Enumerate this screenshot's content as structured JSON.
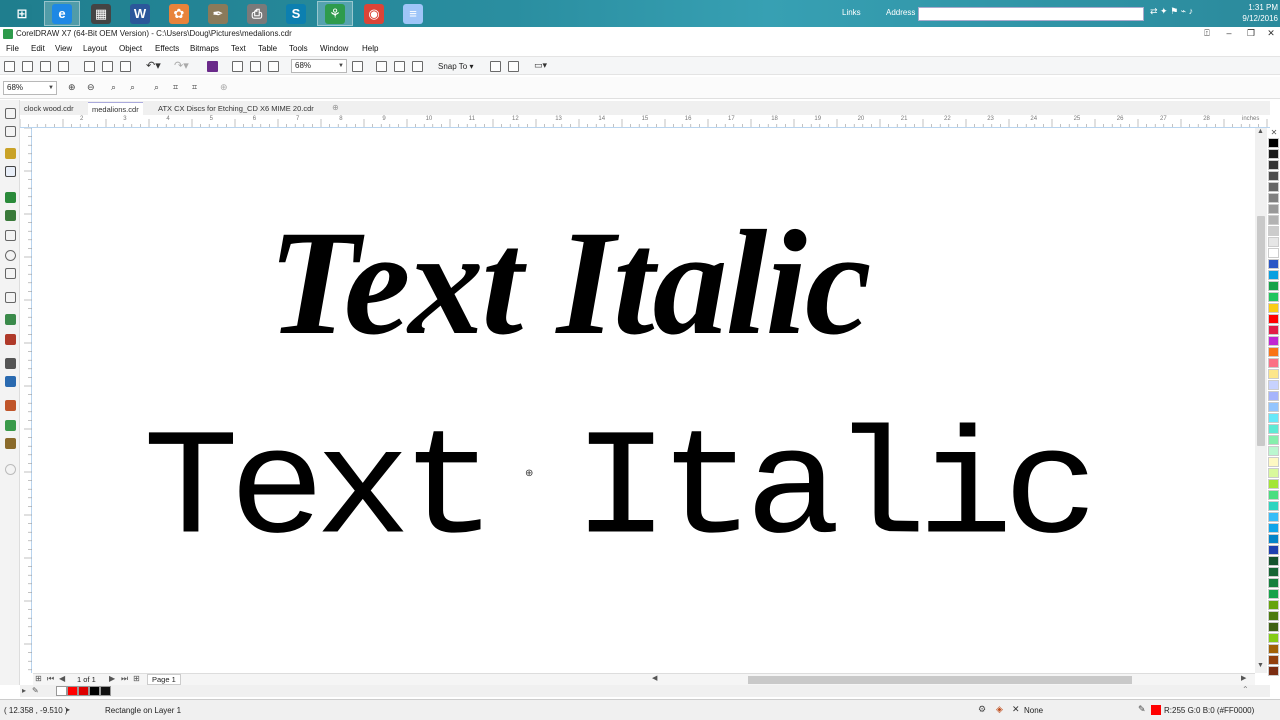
{
  "taskbar": {
    "apps": [
      {
        "name": "windows-start-icon",
        "glyph": "⊞",
        "color": "#1f7e8e"
      },
      {
        "name": "internet-explorer-icon",
        "glyph": "e",
        "color": "#1e88e5"
      },
      {
        "name": "film-app-icon",
        "glyph": "▦",
        "color": "#444444"
      },
      {
        "name": "word-icon",
        "glyph": "W",
        "color": "#2b579a"
      },
      {
        "name": "paint-app-icon",
        "glyph": "✿",
        "color": "#e8833a"
      },
      {
        "name": "pen-app-icon",
        "glyph": "✒",
        "color": "#8a7a5a"
      },
      {
        "name": "printer-app-icon",
        "glyph": "⎙",
        "color": "#7a7a7a"
      },
      {
        "name": "s-app-icon",
        "glyph": "S",
        "color": "#0c7fb0"
      },
      {
        "name": "coreldraw-icon",
        "glyph": "⚘",
        "color": "#2e9b4c"
      },
      {
        "name": "chrome-icon",
        "glyph": "◉",
        "color": "#db4437"
      },
      {
        "name": "notepad-icon",
        "glyph": "≡",
        "color": "#9fc5f8"
      }
    ],
    "links_label": "Links",
    "address_label": "Address",
    "clock_time": "1:31 PM",
    "clock_date": "9/12/2016"
  },
  "window": {
    "title": "CorelDRAW X7 (64-Bit OEM Version) - C:\\Users\\Doug\\Pictures\\medalions.cdr"
  },
  "menu": {
    "items": [
      "File",
      "Edit",
      "View",
      "Layout",
      "Object",
      "Effects",
      "Bitmaps",
      "Text",
      "Table",
      "Tools",
      "Window",
      "Help"
    ]
  },
  "toolbar": {
    "zoom_value": "68%",
    "snap_label": "Snap To"
  },
  "property_bar": {
    "zoom_value": "68%"
  },
  "doc_tabs": [
    "clock wood.cdr",
    "medalions.cdr",
    "ATX CX Discs for Etching_CD X6 MIME 20.cdr"
  ],
  "ruler": {
    "labels": [
      "2",
      "3",
      "4",
      "5",
      "6",
      "7",
      "8",
      "9",
      "10",
      "11",
      "12",
      "13",
      "14",
      "15",
      "16",
      "17",
      "18",
      "19",
      "20",
      "21",
      "22",
      "23",
      "24",
      "25",
      "26",
      "27",
      "28"
    ],
    "units": "inches"
  },
  "canvas": {
    "line1": "Text Italic",
    "line2": "Text Italic"
  },
  "page_nav": {
    "page_count": "1 of 1",
    "page_tab": "Page 1"
  },
  "status": {
    "coordinates": "( 12.358 , -9.510 )",
    "object_info": "Rectangle on Layer 1",
    "fill_label": "None",
    "color_info": "R:255 G:0 B:0 (#FF0000)"
  },
  "palette_colors": [
    "#000000",
    "#1a1a1a",
    "#333333",
    "#4d4d4d",
    "#666666",
    "#808080",
    "#999999",
    "#b3b3b3",
    "#cccccc",
    "#e6e6e6",
    "#ffffff",
    "#2a56c6",
    "#0aa0e0",
    "#16a34a",
    "#22c55e",
    "#facc15",
    "#ff0000",
    "#e11d48",
    "#c026d3",
    "#f97316",
    "#fb7185",
    "#fde68a",
    "#c7d2fe",
    "#a5b4fc",
    "#93c5fd",
    "#67e8f9",
    "#5eead4",
    "#86efac",
    "#bbf7d0",
    "#fef9c3",
    "#d9f99d",
    "#a3e635",
    "#4ade80",
    "#2dd4bf",
    "#38bdf8",
    "#0ea5e9",
    "#0284c7",
    "#1e40af",
    "#14532d",
    "#166534",
    "#15803d",
    "#16a34a",
    "#65a30d",
    "#4d7c0f",
    "#3f6212",
    "#84cc16",
    "#a16207",
    "#92400e",
    "#7c2d12"
  ],
  "doc_palette_colors": [
    "#ffffff",
    "#ff0000",
    "#dd0000",
    "#000000",
    "#111111"
  ]
}
